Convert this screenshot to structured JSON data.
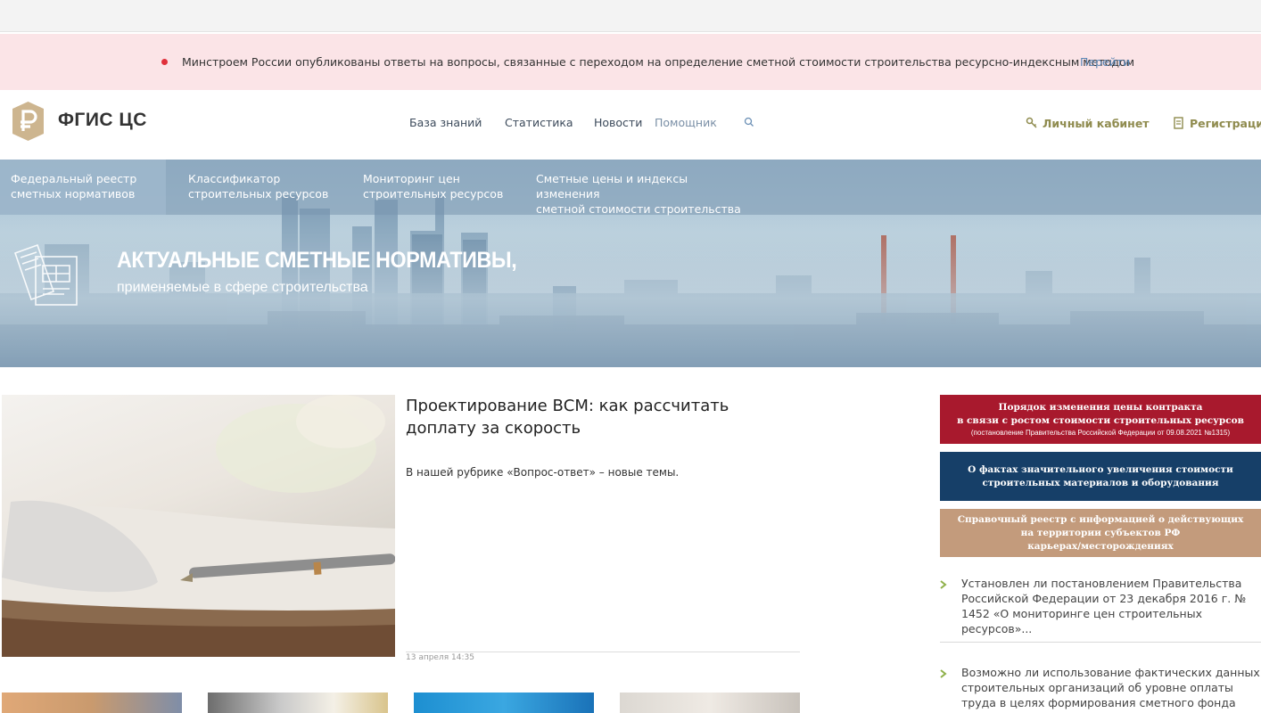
{
  "notice": {
    "text": "Минстроем России опубликованы ответы на вопросы, связанные с переходом на определение сметной стоимости строительства ресурсно-индексным методом",
    "link_label": "Перейти"
  },
  "header": {
    "logo_text": "ФГИС ЦС",
    "nav": [
      "База знаний",
      "Статистика",
      "Новости",
      "Помощник"
    ],
    "account_label": "Личный кабинет",
    "register_label": "Регистрация"
  },
  "menu": [
    {
      "line1": "Федеральный реестр",
      "line2": "сметных нормативов"
    },
    {
      "line1": "Классификатор",
      "line2": "строительных ресурсов"
    },
    {
      "line1": "Мониторинг цен",
      "line2": "строительных ресурсов"
    },
    {
      "line1": "Сметные цены и индексы изменения",
      "line2": "сметной стоимости строительства"
    }
  ],
  "banner": {
    "title": "АКТУАЛЬНЫЕ СМЕТНЫЕ НОРМАТИВЫ,",
    "subtitle": "применяемые в сфере строительства"
  },
  "news": {
    "title": "Проектирование ВСМ: как рассчитать доплату за скорость",
    "lead": "В нашей рубрике «Вопрос-ответ» – новые темы.",
    "date": "13 апреля 14:35"
  },
  "sidebar": {
    "buttons": [
      {
        "line1": "Порядок изменения цены контракта",
        "line2": "в связи с ростом стоимости строительных ресурсов",
        "line3": "(постановление Правительства Российской Федерации от 09.08.2021 №1315)",
        "color": "#a8192d"
      },
      {
        "line1": "О фактах значительного увеличения стоимости",
        "line2": "строительных материалов и оборудования",
        "color": "#163f68"
      },
      {
        "line1": "Справочный реестр с информацией о действующих",
        "line2": "на территории субъектов РФ",
        "line3": "карьерах/месторождениях",
        "color": "#c39b7c"
      }
    ],
    "faq": [
      "Установлен ли постановлением Правительства Российской Федерации от 23 декабря 2016 г. № 1452 «О мониторинге цен строительных ресурсов»...",
      "Возможно ли использование фактических данных строительных организаций об уровне оплаты труда в целях формирования сметного фонда оплаты труда..."
    ]
  },
  "colors": {
    "alert_bg": "#fbe4e7",
    "accent_link": "#5b86b4",
    "user_link": "#8f8b4e",
    "faq_arrow": "#8fb04a"
  }
}
